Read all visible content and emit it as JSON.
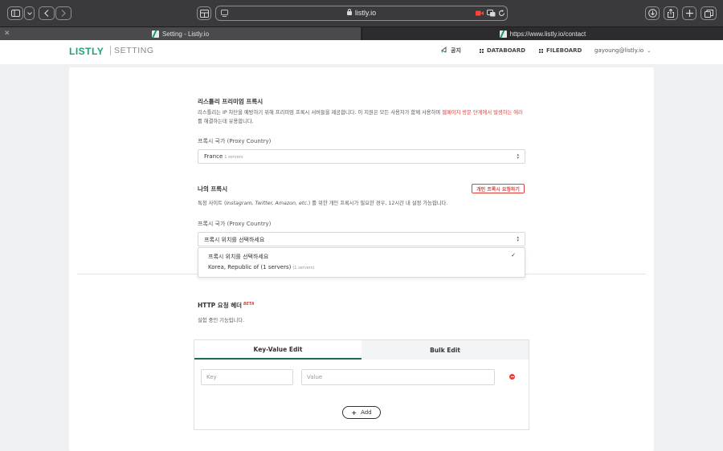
{
  "browser": {
    "url": "listly.io",
    "tabs": [
      {
        "label": "Setting - Listly.io",
        "active": true
      },
      {
        "label": "https://www.listly.io/contact",
        "active": false
      }
    ]
  },
  "header": {
    "logo": "LISTLY",
    "section": "SETTING",
    "nav": [
      {
        "label": "공지",
        "icon": "megaphone-icon"
      },
      {
        "label": "DATABOARD",
        "icon": "grid-icon"
      },
      {
        "label": "FILEBOARD",
        "icon": "grid-icon"
      }
    ],
    "user": "gayoung@listly.io"
  },
  "premium_proxy": {
    "title": "리스틀리 프리미엄 프록시",
    "desc_1": "리스틀리는 IP 차단을 예방하기 위해 프리미엄 프록시 서버들을 제공합니다. 이 지원은 모든 사용자가 함께 사용하며",
    "desc_warn": "웹페이지 방문 단계에서 발생하는 에러",
    "desc_2": " 를 해결하는데 유용합니다.",
    "country_label": "프록시 국가 (Proxy Country)",
    "selected_country": "France",
    "selected_servers": "1 servers"
  },
  "my_proxy": {
    "title": "나의 프록시",
    "request_button": "개인 프록시 요청하기",
    "desc_1": "특정 사이트 (",
    "desc_sites": "Instagram, Twitter, Amazon, etc.",
    "desc_2": ") 를 위한 개인 프록시가 필요한 경우, 12시간 내 설정 가능합니다.",
    "country_label": "프록시 국가 (Proxy Country)",
    "placeholder": "프록시 위치를 선택하세요",
    "options": [
      {
        "label": "프록시 위치를 선택하세요",
        "selected": true
      },
      {
        "label": "Korea, Republic of (1 servers)",
        "note": "(1 servers)"
      }
    ]
  },
  "http_header": {
    "title": "HTTP 요청 헤더",
    "badge": "BETA",
    "desc": "실험 중인 기능입니다.",
    "tabs": [
      "Key-Value Edit",
      "Bulk Edit"
    ],
    "key_placeholder": "Key",
    "value_placeholder": "Value",
    "add_label": "Add"
  },
  "colors": {
    "brand": "#17a673",
    "accent_red": "#e0403c",
    "tab_underline": "#1d6b53"
  }
}
